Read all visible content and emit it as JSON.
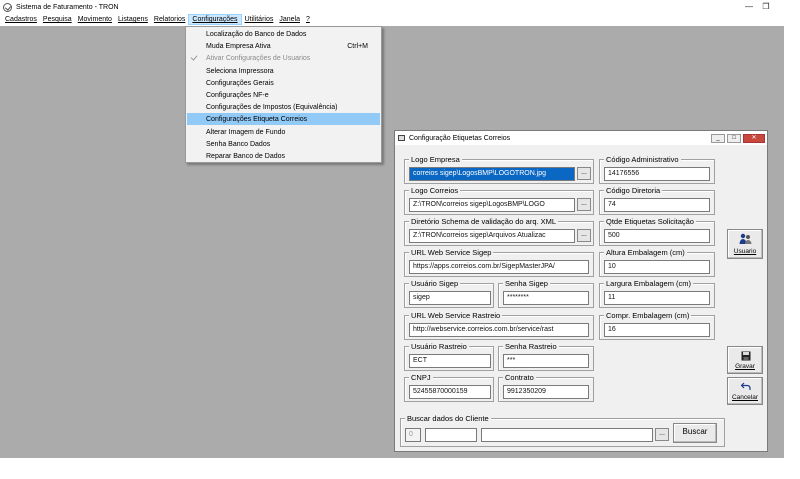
{
  "window": {
    "title": "Sistema de Faturamento - TRON",
    "minimize_glyph": "—",
    "restore_glyph": "❐"
  },
  "menubar": [
    {
      "label": "Cadastros"
    },
    {
      "label": "Pesquisa"
    },
    {
      "label": "Movimento"
    },
    {
      "label": "Listagens"
    },
    {
      "label": "Relatorios"
    },
    {
      "label": "Configurações"
    },
    {
      "label": "Utilitários"
    },
    {
      "label": "Janela"
    },
    {
      "label": "?"
    }
  ],
  "dropdown": {
    "items": [
      {
        "label": "Localização do Banco de Dados",
        "shortcut": ""
      },
      {
        "label": "Muda Empresa Ativa",
        "shortcut": "Ctrl+M"
      },
      {
        "label": "Ativar Configurações de Usuarios",
        "shortcut": ""
      },
      {
        "label": "Seleciona Impressora",
        "shortcut": ""
      },
      {
        "label": "Configurações Gerais",
        "shortcut": ""
      },
      {
        "label": "Configurações NF-e",
        "shortcut": ""
      },
      {
        "label": "Configurações de Impostos (Equivalência)",
        "shortcut": ""
      },
      {
        "label": "Configurações Etiqueta Correios",
        "shortcut": ""
      },
      {
        "label": "Alterar Imagem de Fundo",
        "shortcut": ""
      },
      {
        "label": "Senha Banco Dados",
        "shortcut": ""
      },
      {
        "label": "Reparar Banco de Dados",
        "shortcut": ""
      }
    ]
  },
  "dialog": {
    "title": "Configuração Etiquetas Correios",
    "ellipsis": "...",
    "logo_empresa": {
      "label": "Logo Empresa",
      "value": "correios sigep\\LogosBMP\\LOGOTRON.jpg"
    },
    "logo_correios": {
      "label": "Logo Correios",
      "value": "Z:\\TRON\\correios sigep\\LogosBMP\\LOGO"
    },
    "schema_dir": {
      "label": "Diretório Schema de validação do arq. XML",
      "value": "Z:\\TRON\\correios sigep\\Arquivos Atualizac"
    },
    "url_sigep": {
      "label": "URL Web Service Sigep",
      "value": "https://apps.correios.com.br/SigepMasterJPA/"
    },
    "usuario_sigep": {
      "label": "Usuário Sigep",
      "value": "sigep"
    },
    "senha_sigep": {
      "label": "Senha Sigep",
      "value": "********"
    },
    "url_rastreio": {
      "label": "URL Web Service Rastreio",
      "value": "http://webservice.correios.com.br/service/rast"
    },
    "usuario_rastreio": {
      "label": "Usuário Rastreio",
      "value": "ECT"
    },
    "senha_rastreio": {
      "label": "Senha Rastreio",
      "value": "***"
    },
    "cnpj": {
      "label": "CNPJ",
      "value": "52455870000159"
    },
    "contrato": {
      "label": "Contrato",
      "value": "9912350209"
    },
    "codigo_admin": {
      "label": "Código Administrativo",
      "value": "14176556"
    },
    "codigo_diretoria": {
      "label": "Código Diretoria",
      "value": "74"
    },
    "qtde_etiquetas": {
      "label": "Qtde Etiquetas Solicitação",
      "value": "500"
    },
    "altura": {
      "label": "Altura Embalagem (cm)",
      "value": "10"
    },
    "largura": {
      "label": "Largura Embalagem (cm)",
      "value": "11"
    },
    "comprimento": {
      "label": "Compr. Embalagem (cm)",
      "value": "16"
    },
    "buscar_cliente": {
      "label": "Buscar dados do Cliente",
      "code_value": "0",
      "button": "Buscar"
    },
    "buttons": {
      "usuario": "Usuario",
      "gravar": "Gravar",
      "cancelar": "Cancelar"
    }
  }
}
